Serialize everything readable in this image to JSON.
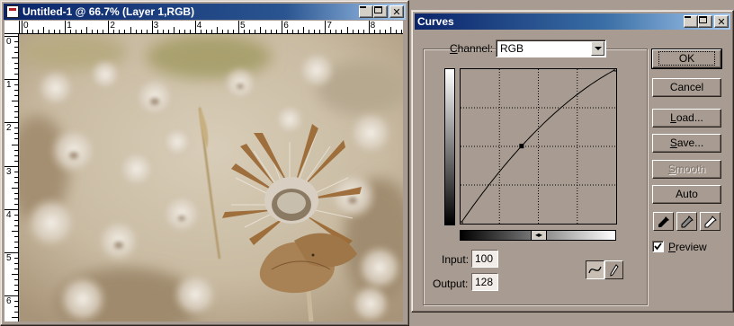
{
  "document_window": {
    "title": "Untitled-1 @ 66.7% (Layer 1,RGB)",
    "icon": "photoshop-document-icon",
    "ruler_top_labels": [
      "0",
      "1",
      "2",
      "3",
      "4",
      "5",
      "6",
      "7",
      "8"
    ],
    "ruler_left_labels": [
      "0",
      "1",
      "2",
      "3",
      "4",
      "5",
      "6"
    ]
  },
  "curves_dialog": {
    "title": "Curves",
    "channel_label_prefix": "",
    "channel_label_mnemonic": "C",
    "channel_label_rest": "hannel:",
    "channel_value": "RGB",
    "input_label": "Input:",
    "input_value": "100",
    "output_label": "Output:",
    "output_value": "128",
    "buttons": {
      "ok": "OK",
      "cancel": "Cancel",
      "load_mnemonic": "L",
      "load_rest": "oad...",
      "save_mnemonic": "S",
      "save_rest": "ave...",
      "smooth_mnemonic": "S",
      "smooth_rest": "mooth",
      "auto": "Auto"
    },
    "smooth_enabled": false,
    "preview_checked": true,
    "preview_mnemonic": "P",
    "preview_rest": "review",
    "curve_point": {
      "input": 100,
      "output": 128
    },
    "tools": [
      "curve-tool-icon",
      "pencil-tool-icon"
    ],
    "eyedroppers": [
      "black-eyedropper-icon",
      "gray-eyedropper-icon",
      "white-eyedropper-icon"
    ]
  },
  "colors": {
    "title_active": "#0a246a",
    "dialog_face": "#a89b91"
  }
}
